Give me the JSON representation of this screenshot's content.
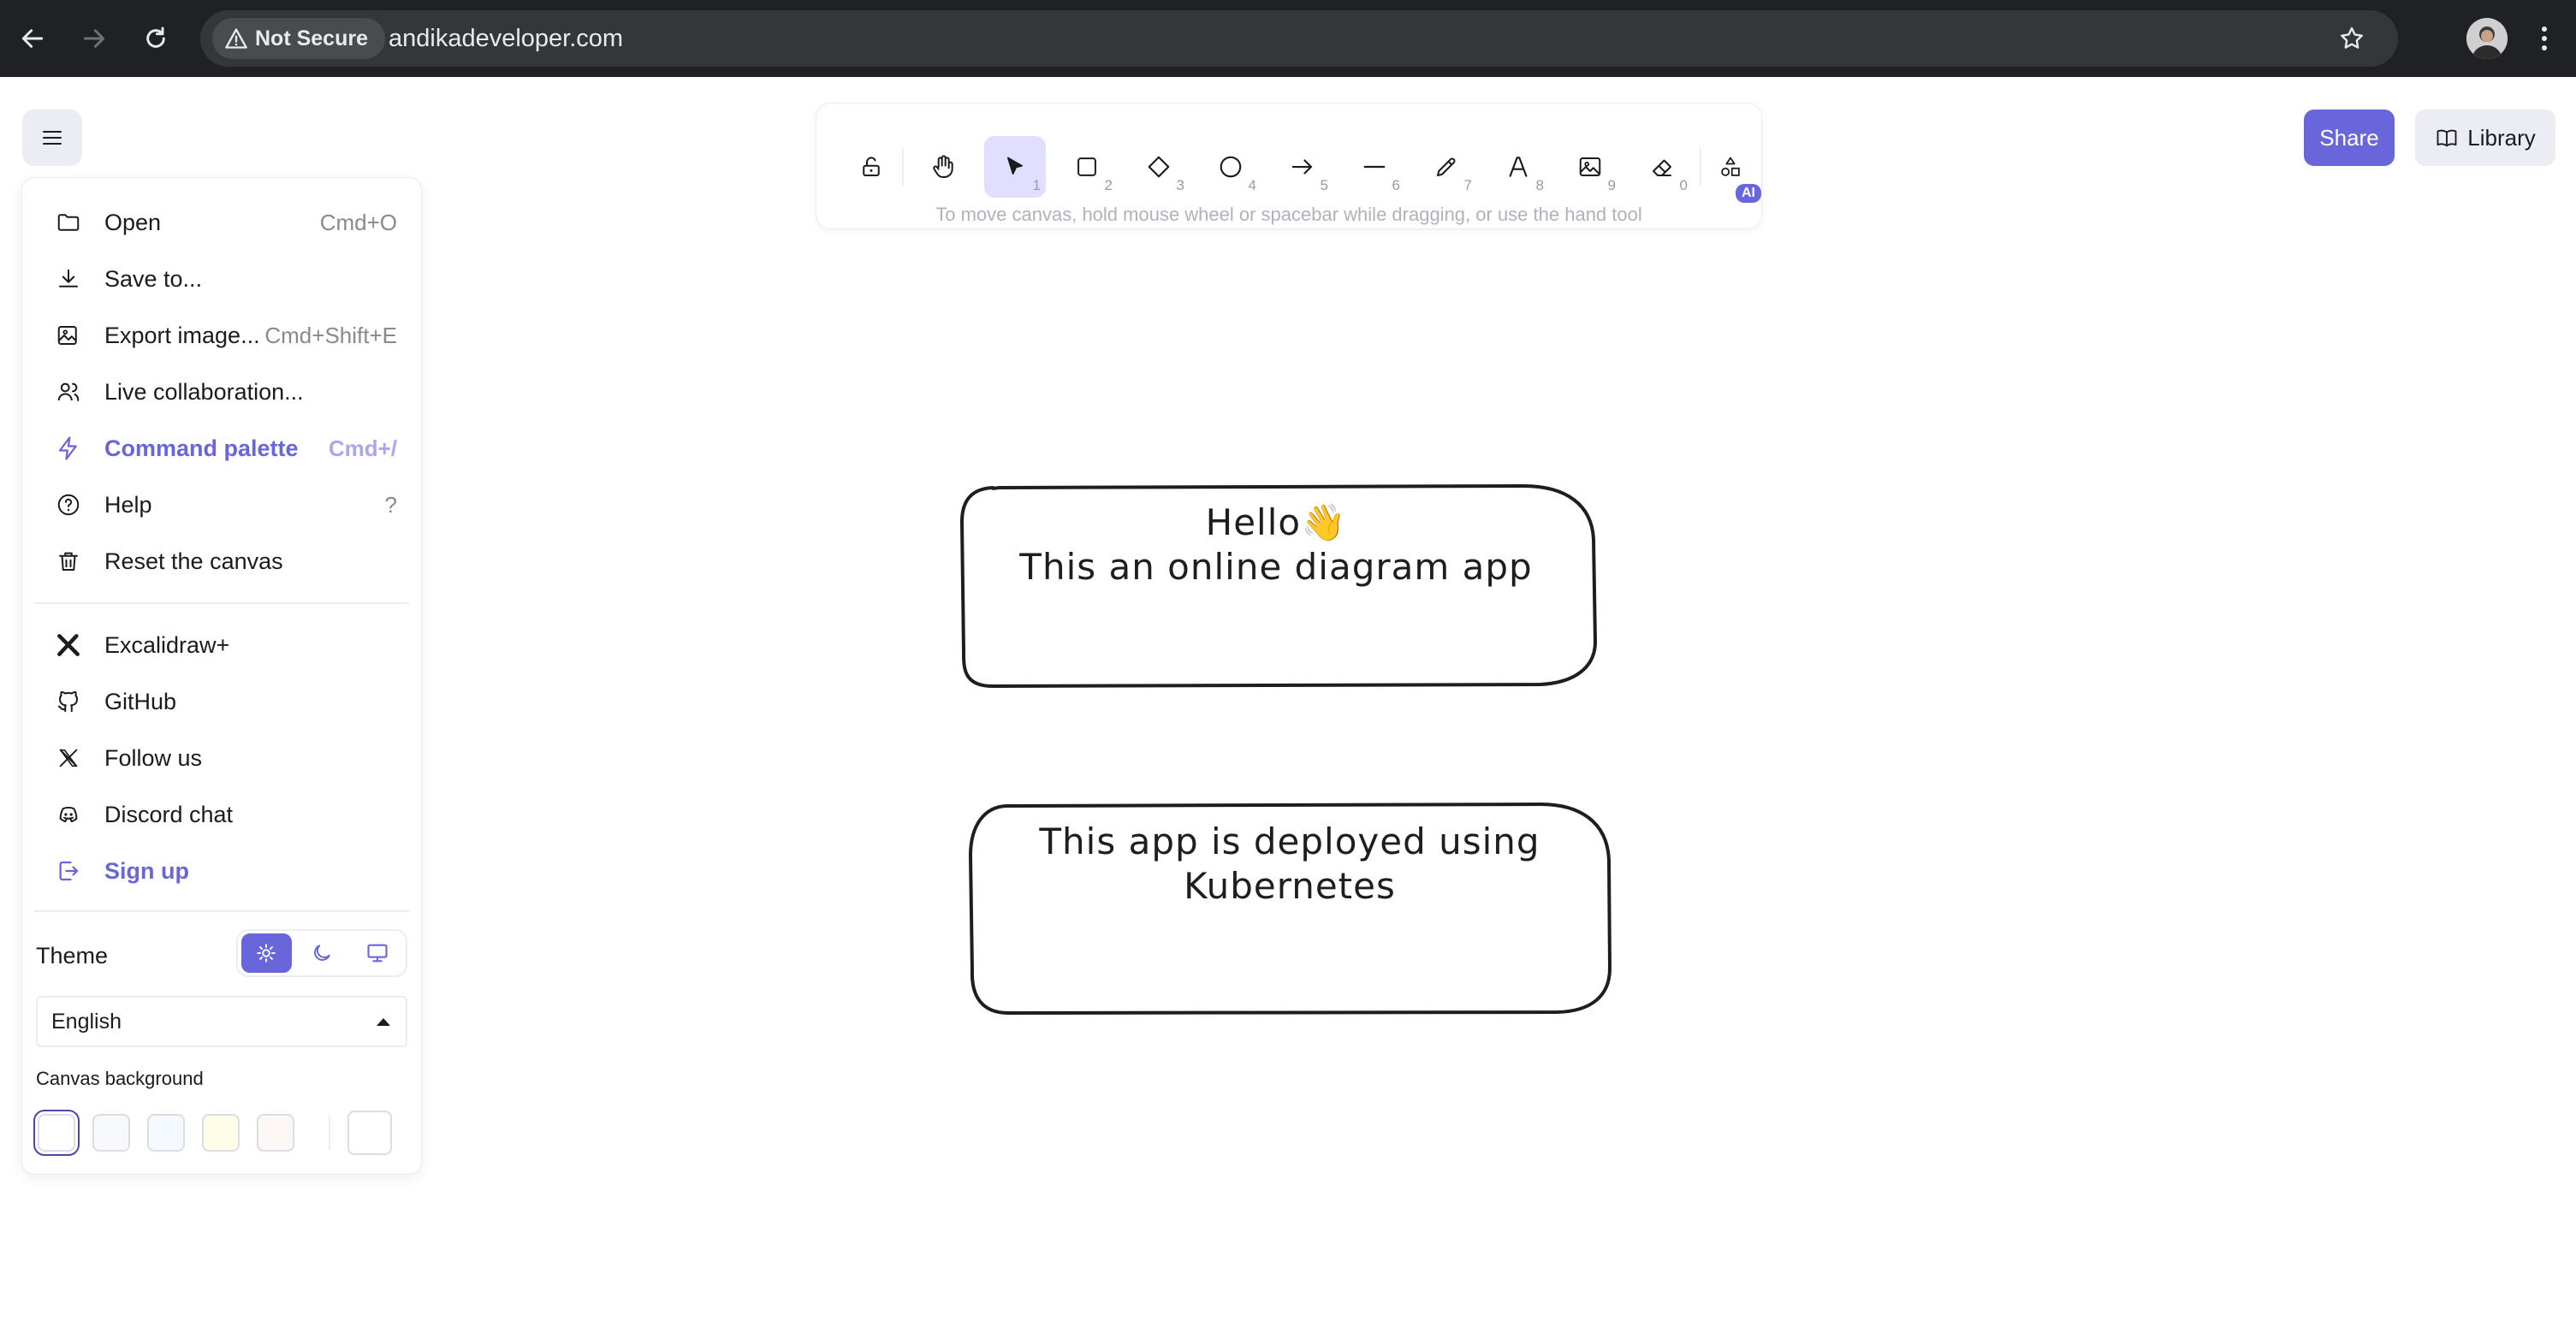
{
  "browser": {
    "security_label": "Not Secure",
    "url": "andikadeveloper.com"
  },
  "menu": {
    "items": [
      {
        "label": "Open",
        "shortcut": "Cmd+O"
      },
      {
        "label": "Save to...",
        "shortcut": ""
      },
      {
        "label": "Export image...",
        "shortcut": "Cmd+Shift+E"
      },
      {
        "label": "Live collaboration...",
        "shortcut": ""
      },
      {
        "label": "Command palette",
        "shortcut": "Cmd+/"
      },
      {
        "label": "Help",
        "shortcut": "?"
      },
      {
        "label": "Reset the canvas",
        "shortcut": ""
      }
    ],
    "links": [
      {
        "label": "Excalidraw+"
      },
      {
        "label": "GitHub"
      },
      {
        "label": "Follow us"
      },
      {
        "label": "Discord chat"
      },
      {
        "label": "Sign up"
      }
    ],
    "theme_label": "Theme",
    "theme_selected": "light",
    "language": "English",
    "canvas_background_label": "Canvas background",
    "background_colors": [
      "#ffffff",
      "#f8f9fa",
      "#f5faff",
      "#fffce8",
      "#fdf8f6",
      "#ffffff"
    ],
    "selected_background": "#ffffff"
  },
  "toolbar": {
    "tools": [
      {
        "name": "lock",
        "shortcut": ""
      },
      {
        "name": "hand",
        "shortcut": ""
      },
      {
        "name": "selection",
        "shortcut": "1"
      },
      {
        "name": "rectangle",
        "shortcut": "2"
      },
      {
        "name": "diamond",
        "shortcut": "3"
      },
      {
        "name": "ellipse",
        "shortcut": "4"
      },
      {
        "name": "arrow",
        "shortcut": "5"
      },
      {
        "name": "line",
        "shortcut": "6"
      },
      {
        "name": "draw",
        "shortcut": "7"
      },
      {
        "name": "text",
        "shortcut": "8"
      },
      {
        "name": "image",
        "shortcut": "9"
      },
      {
        "name": "eraser",
        "shortcut": "0"
      },
      {
        "name": "more-tools",
        "shortcut": ""
      }
    ],
    "active_tool": "selection",
    "ai_badge": "AI"
  },
  "hint": "To move canvas, hold mouse wheel or spacebar while dragging, or use the hand tool",
  "header": {
    "share_label": "Share",
    "library_label": "Library"
  },
  "canvas": {
    "box1_line1": "Hello👋",
    "box1_line2": "This an online diagram app",
    "box2_line1": "This app is deployed using",
    "box2_line2": "Kubernetes"
  },
  "colors": {
    "accent": "#6965db",
    "accent_light": "#e0dfff"
  }
}
